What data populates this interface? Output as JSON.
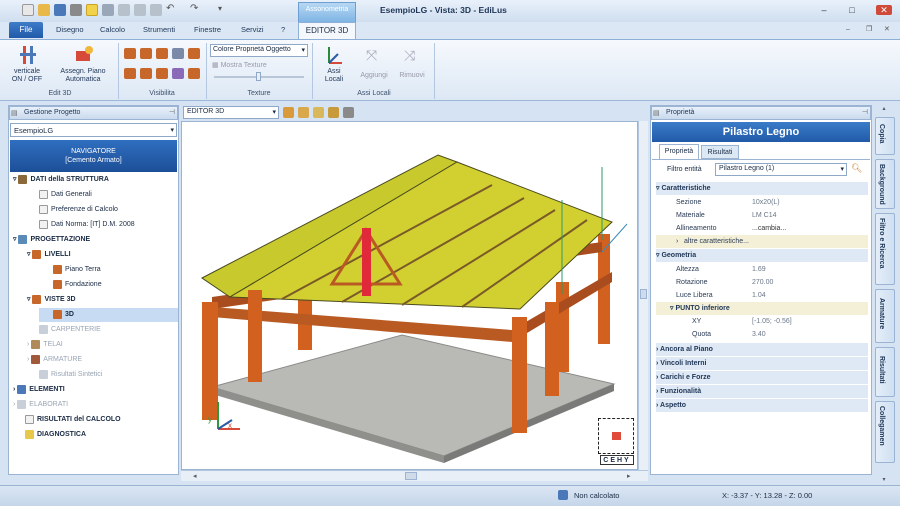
{
  "title": {
    "app": "EsempioLG  -  Vista: 3D  -  EdiLus",
    "contextual_group": "Assonometria"
  },
  "menu": {
    "file": "File",
    "tabs": [
      "Disegno",
      "Calcolo",
      "Strumenti",
      "Finestre",
      "Servizi",
      "?"
    ],
    "active_tab": "EDITOR 3D"
  },
  "ribbon": {
    "verticale": "verticale\nON / OFF",
    "assegn_piano": "Assegn. Piano\nAutomatica",
    "edit3d_label": "Edit 3D",
    "visibilita_label": "Visibilita",
    "color_select": "Colore Proprietà Oggetto",
    "mostra_texture": "Mostra Texture",
    "texture_label": "Texture",
    "assi_locali": "Assi\nLocali",
    "aggiungi": "Aggiungi",
    "rimuovi": "Rimuovi",
    "assi_locali_label": "Assi Locali"
  },
  "left_panel": {
    "title": "Gestione Progetto",
    "project_select": "EsempioLG",
    "navigator_line1": "NAVIGATORE",
    "navigator_line2": "[Cemento Armato]",
    "tree": [
      "DATI della STRUTTURA",
      "Dati Generali",
      "Preferenze di Calcolo",
      "Dati Norma: [IT] D.M. 2008",
      "PROGETTAZIONE",
      "LIVELLI",
      "Piano Terra",
      "Fondazione",
      "VISTE 3D",
      "3D",
      "CARPENTERIE",
      "TELAI",
      "ARMATURE",
      "Risultati Sintetici",
      "ELEMENTI",
      "ELABORATI",
      "RISULTATI del CALCOLO",
      "DIAGNOSTICA"
    ]
  },
  "viewport": {
    "editor_select": "EDITOR 3D",
    "nav_cube_label": "CEHY",
    "axis_x": "x",
    "axis_y": "y"
  },
  "properties": {
    "panel_title": "Proprietà",
    "header": "Pilastro Legno",
    "tabs": [
      "Proprietà",
      "Risultati"
    ],
    "filter_label": "Filtro entità",
    "filter_value": "Pilastro Legno (1)",
    "caratteristiche": "Caratteristiche",
    "sezione_l": "Sezione",
    "sezione_v": "10x20(L)",
    "materiale_l": "Materiale",
    "materiale_v": "LM C14",
    "allineamento_l": "Allineamento",
    "allineamento_v": "...cambia...",
    "altre": "altre caratteristiche...",
    "geometria": "Geometria",
    "altezza_l": "Altezza",
    "altezza_v": "1.69",
    "rotazione_l": "Rotazione",
    "rotazione_v": "270.00",
    "luce_l": "Luce Libera",
    "luce_v": "1.04",
    "punto_inferiore": "PUNTO inferiore",
    "xy_l": "XY",
    "xy_v": "[-1.05; -0.56]",
    "quota_l": "Quota",
    "quota_v": "3.40",
    "ancora": "Ancora al Piano",
    "vincoli": "Vincoli Interni",
    "carichi": "Carichi e Forze",
    "funzionalita": "Funzionalità",
    "aspetto": "Aspetto"
  },
  "side_tabs": [
    "Copia",
    "Background",
    "Filtro e Ricerca",
    "Armature",
    "Risultati",
    "Collegamen"
  ],
  "status": {
    "calc": "Non calcolato",
    "coords": "X: -3.37 - Y: 13.28 - Z: 0.00"
  }
}
